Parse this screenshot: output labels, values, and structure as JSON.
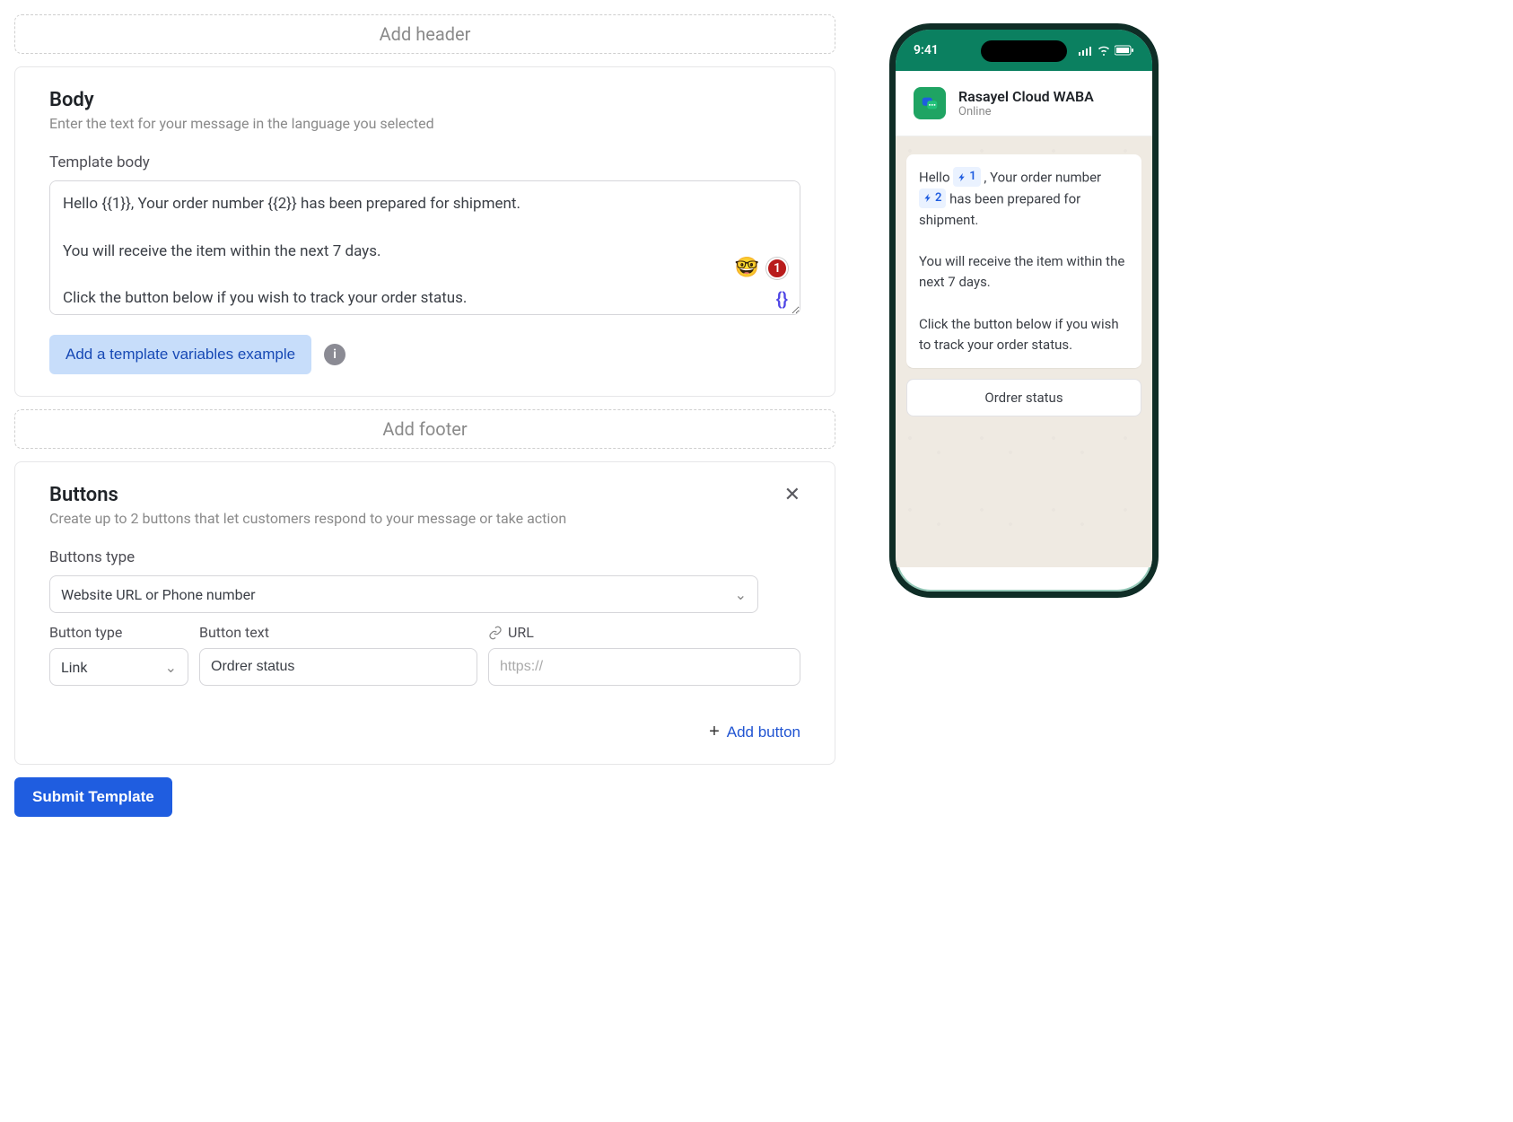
{
  "header": {
    "add_label": "Add header"
  },
  "body": {
    "title": "Body",
    "subtitle": "Enter the text for your message in the language you selected",
    "field_label": "Template body",
    "content": "Hello {{1}}, Your order number {{2}} has been prepared for shipment.\n\nYou will receive the item within the next 7 days.\n\nClick the button below if you wish to track your order status.",
    "emoji": "🤓",
    "error_count": "1",
    "vars_example_btn": "Add a template variables example"
  },
  "footer": {
    "add_label": "Add footer"
  },
  "buttons_section": {
    "title": "Buttons",
    "subtitle": "Create up to 2 buttons that let customers respond to your message or take action",
    "type_label": "Buttons type",
    "type_value": "Website URL or Phone number",
    "columns": {
      "type": "Button type",
      "text": "Button text",
      "url": "URL"
    },
    "row": {
      "type": "Link",
      "text": "Ordrer status",
      "url_placeholder": "https://"
    },
    "add_btn": "Add button"
  },
  "submit": {
    "label": "Submit Template"
  },
  "preview": {
    "time": "9:41",
    "contact_name": "Rasayel Cloud WABA",
    "contact_status": "Online",
    "msg_parts": {
      "p1a": "Hello ",
      "v1": "1",
      "p1b": " , Your order number ",
      "v2": "2",
      "p1c": " has been prepared for shipment.",
      "p2": "You will receive the item within the next 7 days.",
      "p3": "Click the button below if you wish to track your order status."
    },
    "button_label": "Ordrer status"
  }
}
